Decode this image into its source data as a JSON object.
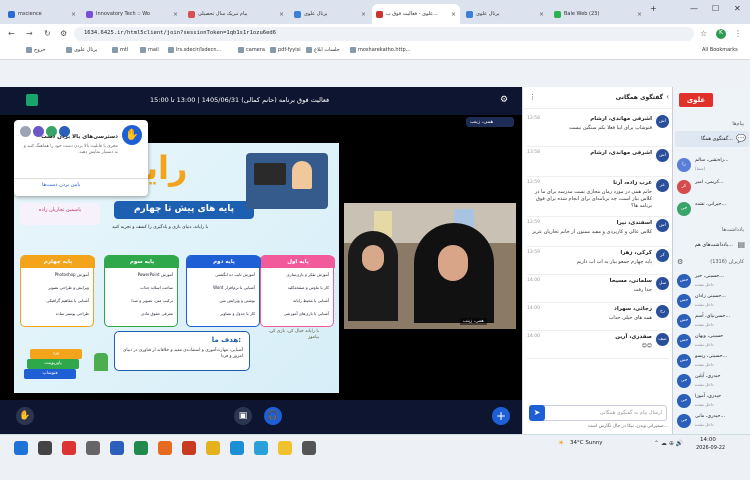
{
  "browser": {
    "tabs": [
      {
        "label": "mscience",
        "fav": "#2b6cd4"
      },
      {
        "label": "Innovatory Tech :: Wo",
        "fav": "#7a4fd8"
      },
      {
        "label": "پیام تبریک سال تحصیلی",
        "fav": "#d84f4f"
      },
      {
        "label": "پرتال علوی",
        "fav": "#3c7fd6"
      },
      {
        "label": "علوی - فعالیت فوق ب...",
        "fav": "#c33",
        "active": true
      },
      {
        "label": "پرتال علوی",
        "fav": "#3c7fd6"
      },
      {
        "label": "Bale Web (23)",
        "fav": "#2bb24c"
      }
    ],
    "new_tab": "+",
    "url": "1634.6425.ir/html5client/join?sessionToken=1qb1s1r1ozu6ed6",
    "bookmarks": [
      "خروج",
      "پرتال علوی",
      "mtl",
      "mail",
      "lrs.sdecir/lsdecn...",
      "camera",
      "pdf-fyyisi",
      "جلسات ابلاغ",
      "mosharekatho.http..."
    ],
    "all_bookmarks": "All Bookmarks"
  },
  "meeting": {
    "title": "فعالیت فوق برنامه (حانم کمالی)   1405/06/31 | 13:00 تا 15:00",
    "presenter_tag": "همی، زینب",
    "cam_label": "همی، زینب"
  },
  "panel_popup": {
    "title": "دسترسی‌های بالا بردن دست",
    "body": "مجری با قابلیت بالا بردن دست خود را هماهنگ کنید و به دستیار نمایش دهید.",
    "button": "پایین بردن دست‌ها"
  },
  "slide": {
    "brand": "رایا",
    "headline": "پایه های پیش تا چهارم",
    "subline": "با رایانه، دنیای بازی و یادگیری را کشف و تجربه کنید",
    "teacher": "یاسمین تجاریان زاده",
    "grade_titles": [
      "پایه اول",
      "پایه دوم",
      "پایه سوم",
      "پایه چهارم"
    ],
    "grade_items": [
      [
        "آموزش تفکر و بازی‌سازی",
        "کار با ماوس و صفحه‌کلید",
        "آشنایی با محیط رایانه",
        "آشنایی با بازی‌های آموزشی"
      ],
      [
        "آموزش تایپ ده انگشتی",
        "آشنایی با نرم‌افزار Word",
        "نوشتن و ویرایش متن",
        "کار با جدول و تصاویر"
      ],
      [
        "آموزش PowerPoint",
        "ساخت اسلاید جذاب",
        "ترکیب متن، تصویر و صدا",
        "معرفی حقوق مادی"
      ],
      [
        "آموزش Photoshop",
        "ویرایش و طراحی تصویر",
        "آشنایی با مفاهیم گرافیکی",
        "طراحی پوستر ساده"
      ]
    ],
    "goal_title": "هدف ما:",
    "goal_text": "آشنایی، مهارت‌آموزی و استفاده‌ی مفید و خلاقانه از فناوری در دنیای امروز و فردا",
    "badge_left": "با رایانه خیال کن، بازی کن، بیاموز",
    "book_labels": [
      "فتوشاپ",
      "پاورپوینت",
      "ورد"
    ]
  },
  "chat": {
    "header": "گفتگوی همگانی",
    "messages": [
      {
        "name": "اشرفی مهاندی، ارشام",
        "time": "13:58",
        "text": "فتوشاپ برای ایبا فعلا یکم سنگین نیست"
      },
      {
        "name": "اشرفی مهاندی، ارشام",
        "time": "13:58",
        "text": ""
      },
      {
        "name": "عرب زاده، آرنا",
        "time": "13:59",
        "text": "خانم همی در مورد رمان مجازی تست مدرسه برای ما در کلاس نیاز است، چه برنامه‌ای برای انجام شده برای فوق برنامه ها؟"
      },
      {
        "name": "اسفندی، نیرا",
        "time": "13:59",
        "text": "کلاس عالی و کاربردی و مفید ممنون از خانم تجاریان عزیز"
      },
      {
        "name": "کرکی، زهرا",
        "time": "13:59",
        "text": "پایه چهارم جمعو بیار به اب اب داریم"
      },
      {
        "name": "سلمانی، مسیحا",
        "time": "14:00",
        "text": "جدا رفت"
      },
      {
        "name": "رجائی، سهراد",
        "time": "14:00",
        "text": "همه های خیلی جذاب"
      },
      {
        "name": "صفدری، آرین",
        "time": "14:00",
        "text": "😊😊"
      }
    ],
    "input_placeholder": "ارسال پیام به گفتگوی همگانی",
    "typing": "صمیرانی ویدن، نیکا در حال نگارش است..."
  },
  "sidebar": {
    "logo": "علوی",
    "section_messages": "پیام‌ها",
    "chat_item": "گفتگوی همگا...",
    "notes_section": "یادداشت‌ها",
    "notes_item": "یادداشت‌های هم...",
    "users_header": "کاربران (1316)",
    "users": [
      {
        "name": "راه‌تشی، سالم...",
        "status": "(شما)",
        "color": "#5b7fd6"
      },
      {
        "name": "کریمی، امیر...",
        "status": "",
        "color": "#d64b4b"
      },
      {
        "name": "جیرانی، تشنه...",
        "status": "",
        "color": "#3aa36a"
      },
      {
        "name": "حسینی، خیر...",
        "status": "داخل نشده",
        "color": "#2b5fb9"
      },
      {
        "name": "حسینی رادان...",
        "status": "داخل نشده",
        "color": "#2b5fb9"
      },
      {
        "name": "حسن‌نیای، آسم...",
        "status": "داخل نشده",
        "color": "#2b5fb9"
      },
      {
        "name": "حسینی، ویهان",
        "status": "داخل نشده",
        "color": "#2b5fb9"
      },
      {
        "name": "حسینی، ریسو...",
        "status": "داخل نشده",
        "color": "#2b5fb9"
      },
      {
        "name": "حیدری، آیلین",
        "status": "داخل نشده",
        "color": "#2b5fb9"
      },
      {
        "name": "حیدری، آموزا",
        "status": "داخل نشده",
        "color": "#2b5fb9"
      },
      {
        "name": "حیدری، مانی...",
        "status": "داخل نشده",
        "color": "#2b5fb9"
      }
    ]
  },
  "taskbar": {
    "weather": "34°C  Sunny",
    "time": "14:00",
    "date": "2026-09-22"
  },
  "colors": {
    "accent": "#1e5fd6",
    "dark_bar": "#0d1530",
    "red": "#e0312b"
  }
}
